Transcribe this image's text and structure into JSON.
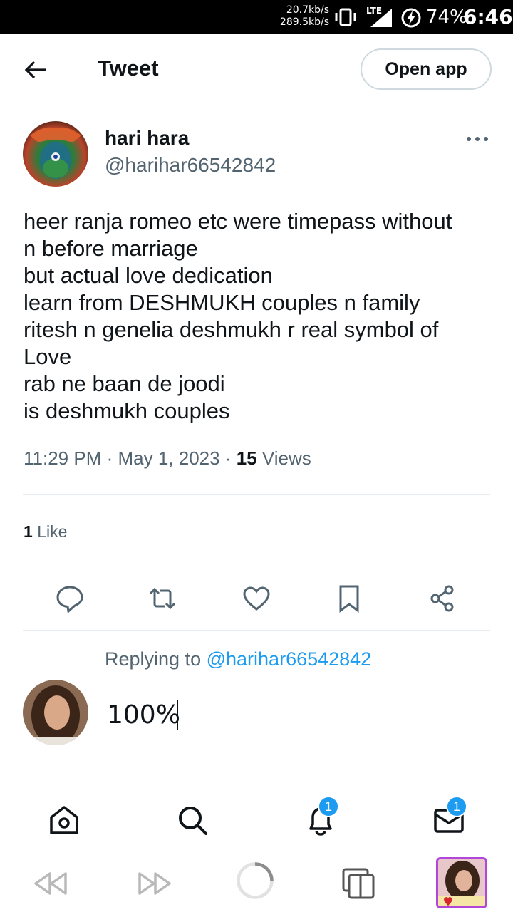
{
  "status_bar": {
    "net_up": "20.7kb/s",
    "net_down": "289.5kb/s",
    "network": "LTE",
    "battery": "74%",
    "time": "6:46"
  },
  "header": {
    "title": "Tweet",
    "open_app_label": "Open app"
  },
  "tweet": {
    "author_name": "hari hara",
    "author_handle": "@harihar66542842",
    "text_lines": [
      "heer ranja romeo etc were timepass without",
      "n before marriage",
      "but actual love dedication",
      "learn from DESHMUKH couples n family",
      "ritesh n genelia deshmukh r real symbol of",
      "Love",
      "rab ne baan de joodi",
      "is deshmukh couples"
    ],
    "time": "11:29 PM",
    "date": "May 1, 2023",
    "views_count": "15",
    "views_label": "Views",
    "likes_count": "1",
    "likes_label": "Like"
  },
  "actions": [
    "reply-icon",
    "retweet-icon",
    "like-icon",
    "bookmark-icon",
    "share-icon"
  ],
  "reply": {
    "replying_to_label": "Replying to",
    "replying_to_handle": "@harihar66542842",
    "draft_text": "100%"
  },
  "bottom_nav": {
    "items": [
      "home-icon",
      "search-icon",
      "notifications-icon",
      "messages-icon"
    ],
    "notifications_badge": "1",
    "messages_badge": "1"
  },
  "browser_bar": {
    "items": [
      "back-icon",
      "forward-icon",
      "loading-icon",
      "tabs-icon",
      "profile-thumbnail"
    ]
  },
  "colors": {
    "accent": "#1d9bf0",
    "text": "#0f1419",
    "secondary_text": "#536471",
    "divider": "#e6ecf0",
    "thumb_border": "#b246d9"
  }
}
